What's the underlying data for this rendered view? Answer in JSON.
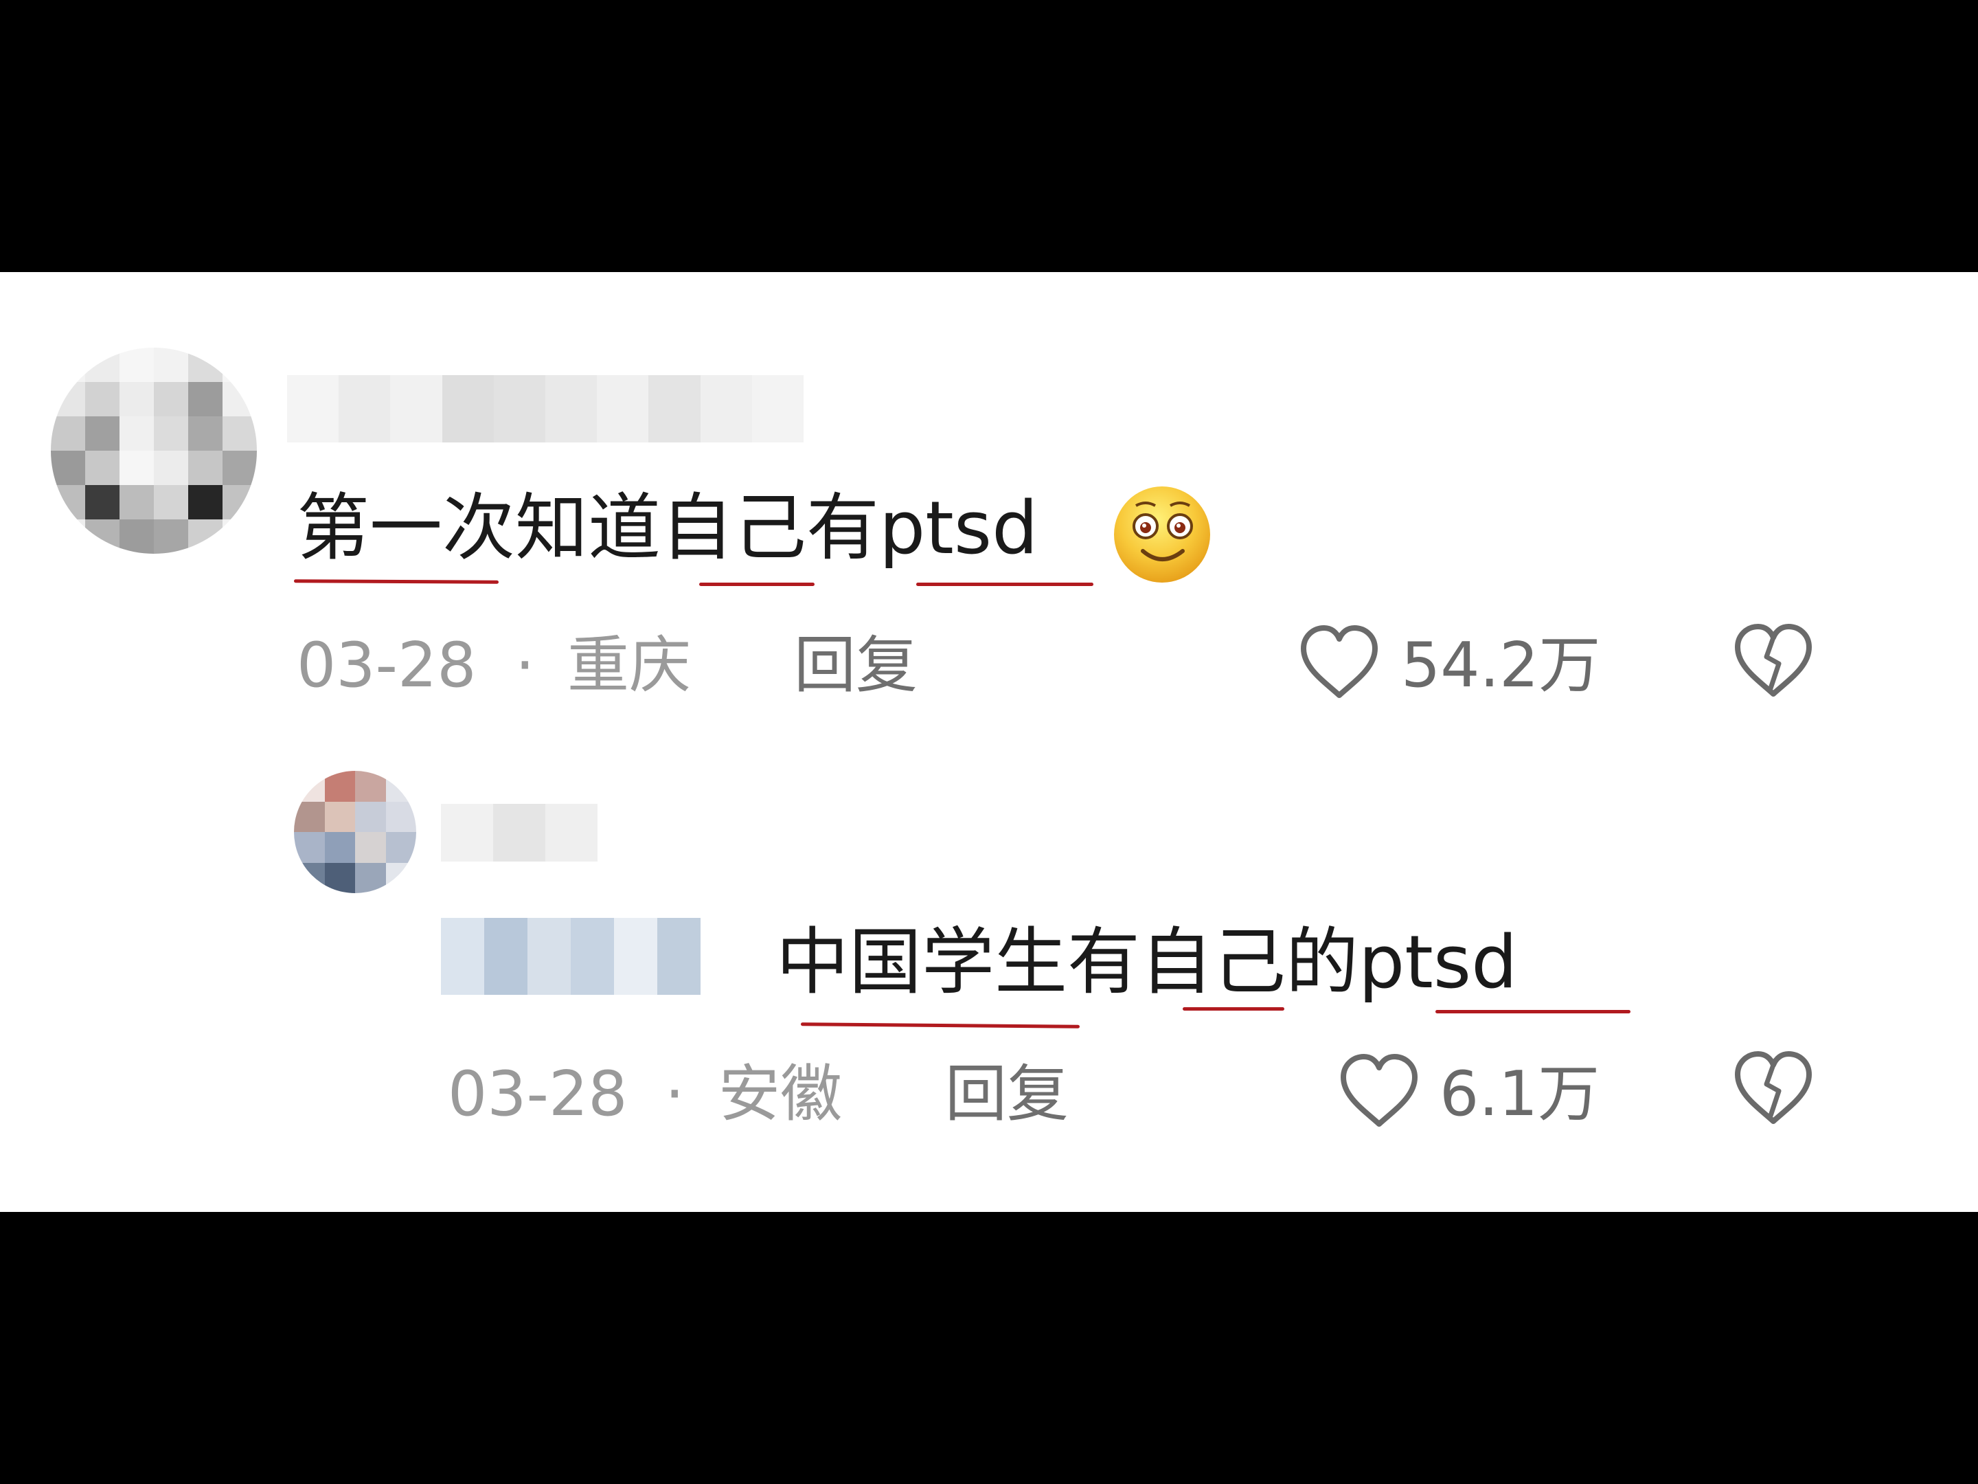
{
  "comments": [
    {
      "text_parts": [
        "第一次知道",
        "自己",
        "有",
        "ptsd"
      ],
      "emoji_icon": "smiling-face-emoji-icon",
      "date": "03-28",
      "separator": "·",
      "location": "重庆",
      "reply_label": "回复",
      "like_count": "54.2万"
    },
    {
      "text_parts": [
        "中国学生",
        "有",
        "自己",
        "的",
        "ptsd"
      ],
      "date": "03-28",
      "separator": "·",
      "location": "安徽",
      "reply_label": "回复",
      "like_count": "6.1万"
    }
  ],
  "colors": {
    "background": "#ffffff",
    "letterbox": "#000000",
    "underline": "#b11a1f",
    "meta_text": "#9a9a9a"
  }
}
